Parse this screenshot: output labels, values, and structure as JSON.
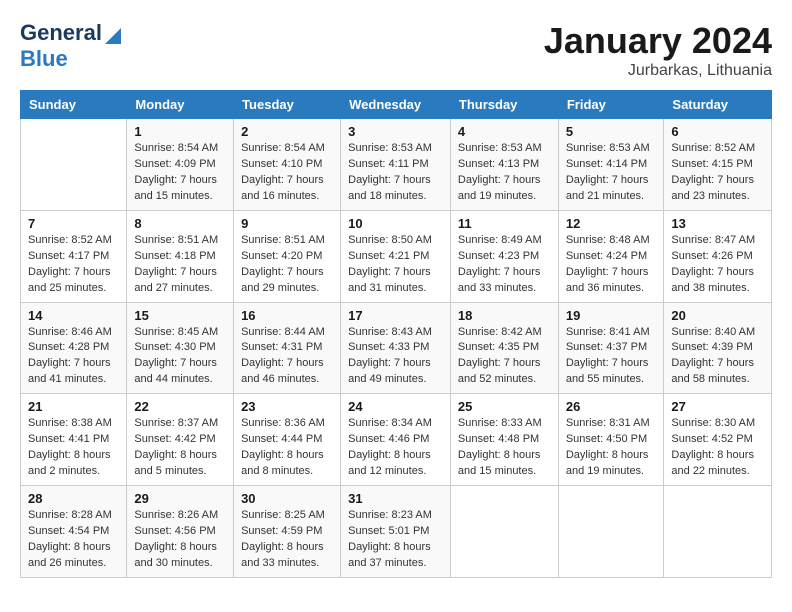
{
  "header": {
    "logo_general": "General",
    "logo_blue": "Blue",
    "title": "January 2024",
    "subtitle": "Jurbarkas, Lithuania"
  },
  "columns": [
    "Sunday",
    "Monday",
    "Tuesday",
    "Wednesday",
    "Thursday",
    "Friday",
    "Saturday"
  ],
  "weeks": [
    [
      {
        "day": "",
        "sunrise": "",
        "sunset": "",
        "daylight": ""
      },
      {
        "day": "1",
        "sunrise": "Sunrise: 8:54 AM",
        "sunset": "Sunset: 4:09 PM",
        "daylight": "Daylight: 7 hours and 15 minutes."
      },
      {
        "day": "2",
        "sunrise": "Sunrise: 8:54 AM",
        "sunset": "Sunset: 4:10 PM",
        "daylight": "Daylight: 7 hours and 16 minutes."
      },
      {
        "day": "3",
        "sunrise": "Sunrise: 8:53 AM",
        "sunset": "Sunset: 4:11 PM",
        "daylight": "Daylight: 7 hours and 18 minutes."
      },
      {
        "day": "4",
        "sunrise": "Sunrise: 8:53 AM",
        "sunset": "Sunset: 4:13 PM",
        "daylight": "Daylight: 7 hours and 19 minutes."
      },
      {
        "day": "5",
        "sunrise": "Sunrise: 8:53 AM",
        "sunset": "Sunset: 4:14 PM",
        "daylight": "Daylight: 7 hours and 21 minutes."
      },
      {
        "day": "6",
        "sunrise": "Sunrise: 8:52 AM",
        "sunset": "Sunset: 4:15 PM",
        "daylight": "Daylight: 7 hours and 23 minutes."
      }
    ],
    [
      {
        "day": "7",
        "sunrise": "Sunrise: 8:52 AM",
        "sunset": "Sunset: 4:17 PM",
        "daylight": "Daylight: 7 hours and 25 minutes."
      },
      {
        "day": "8",
        "sunrise": "Sunrise: 8:51 AM",
        "sunset": "Sunset: 4:18 PM",
        "daylight": "Daylight: 7 hours and 27 minutes."
      },
      {
        "day": "9",
        "sunrise": "Sunrise: 8:51 AM",
        "sunset": "Sunset: 4:20 PM",
        "daylight": "Daylight: 7 hours and 29 minutes."
      },
      {
        "day": "10",
        "sunrise": "Sunrise: 8:50 AM",
        "sunset": "Sunset: 4:21 PM",
        "daylight": "Daylight: 7 hours and 31 minutes."
      },
      {
        "day": "11",
        "sunrise": "Sunrise: 8:49 AM",
        "sunset": "Sunset: 4:23 PM",
        "daylight": "Daylight: 7 hours and 33 minutes."
      },
      {
        "day": "12",
        "sunrise": "Sunrise: 8:48 AM",
        "sunset": "Sunset: 4:24 PM",
        "daylight": "Daylight: 7 hours and 36 minutes."
      },
      {
        "day": "13",
        "sunrise": "Sunrise: 8:47 AM",
        "sunset": "Sunset: 4:26 PM",
        "daylight": "Daylight: 7 hours and 38 minutes."
      }
    ],
    [
      {
        "day": "14",
        "sunrise": "Sunrise: 8:46 AM",
        "sunset": "Sunset: 4:28 PM",
        "daylight": "Daylight: 7 hours and 41 minutes."
      },
      {
        "day": "15",
        "sunrise": "Sunrise: 8:45 AM",
        "sunset": "Sunset: 4:30 PM",
        "daylight": "Daylight: 7 hours and 44 minutes."
      },
      {
        "day": "16",
        "sunrise": "Sunrise: 8:44 AM",
        "sunset": "Sunset: 4:31 PM",
        "daylight": "Daylight: 7 hours and 46 minutes."
      },
      {
        "day": "17",
        "sunrise": "Sunrise: 8:43 AM",
        "sunset": "Sunset: 4:33 PM",
        "daylight": "Daylight: 7 hours and 49 minutes."
      },
      {
        "day": "18",
        "sunrise": "Sunrise: 8:42 AM",
        "sunset": "Sunset: 4:35 PM",
        "daylight": "Daylight: 7 hours and 52 minutes."
      },
      {
        "day": "19",
        "sunrise": "Sunrise: 8:41 AM",
        "sunset": "Sunset: 4:37 PM",
        "daylight": "Daylight: 7 hours and 55 minutes."
      },
      {
        "day": "20",
        "sunrise": "Sunrise: 8:40 AM",
        "sunset": "Sunset: 4:39 PM",
        "daylight": "Daylight: 7 hours and 58 minutes."
      }
    ],
    [
      {
        "day": "21",
        "sunrise": "Sunrise: 8:38 AM",
        "sunset": "Sunset: 4:41 PM",
        "daylight": "Daylight: 8 hours and 2 minutes."
      },
      {
        "day": "22",
        "sunrise": "Sunrise: 8:37 AM",
        "sunset": "Sunset: 4:42 PM",
        "daylight": "Daylight: 8 hours and 5 minutes."
      },
      {
        "day": "23",
        "sunrise": "Sunrise: 8:36 AM",
        "sunset": "Sunset: 4:44 PM",
        "daylight": "Daylight: 8 hours and 8 minutes."
      },
      {
        "day": "24",
        "sunrise": "Sunrise: 8:34 AM",
        "sunset": "Sunset: 4:46 PM",
        "daylight": "Daylight: 8 hours and 12 minutes."
      },
      {
        "day": "25",
        "sunrise": "Sunrise: 8:33 AM",
        "sunset": "Sunset: 4:48 PM",
        "daylight": "Daylight: 8 hours and 15 minutes."
      },
      {
        "day": "26",
        "sunrise": "Sunrise: 8:31 AM",
        "sunset": "Sunset: 4:50 PM",
        "daylight": "Daylight: 8 hours and 19 minutes."
      },
      {
        "day": "27",
        "sunrise": "Sunrise: 8:30 AM",
        "sunset": "Sunset: 4:52 PM",
        "daylight": "Daylight: 8 hours and 22 minutes."
      }
    ],
    [
      {
        "day": "28",
        "sunrise": "Sunrise: 8:28 AM",
        "sunset": "Sunset: 4:54 PM",
        "daylight": "Daylight: 8 hours and 26 minutes."
      },
      {
        "day": "29",
        "sunrise": "Sunrise: 8:26 AM",
        "sunset": "Sunset: 4:56 PM",
        "daylight": "Daylight: 8 hours and 30 minutes."
      },
      {
        "day": "30",
        "sunrise": "Sunrise: 8:25 AM",
        "sunset": "Sunset: 4:59 PM",
        "daylight": "Daylight: 8 hours and 33 minutes."
      },
      {
        "day": "31",
        "sunrise": "Sunrise: 8:23 AM",
        "sunset": "Sunset: 5:01 PM",
        "daylight": "Daylight: 8 hours and 37 minutes."
      },
      {
        "day": "",
        "sunrise": "",
        "sunset": "",
        "daylight": ""
      },
      {
        "day": "",
        "sunrise": "",
        "sunset": "",
        "daylight": ""
      },
      {
        "day": "",
        "sunrise": "",
        "sunset": "",
        "daylight": ""
      }
    ]
  ]
}
